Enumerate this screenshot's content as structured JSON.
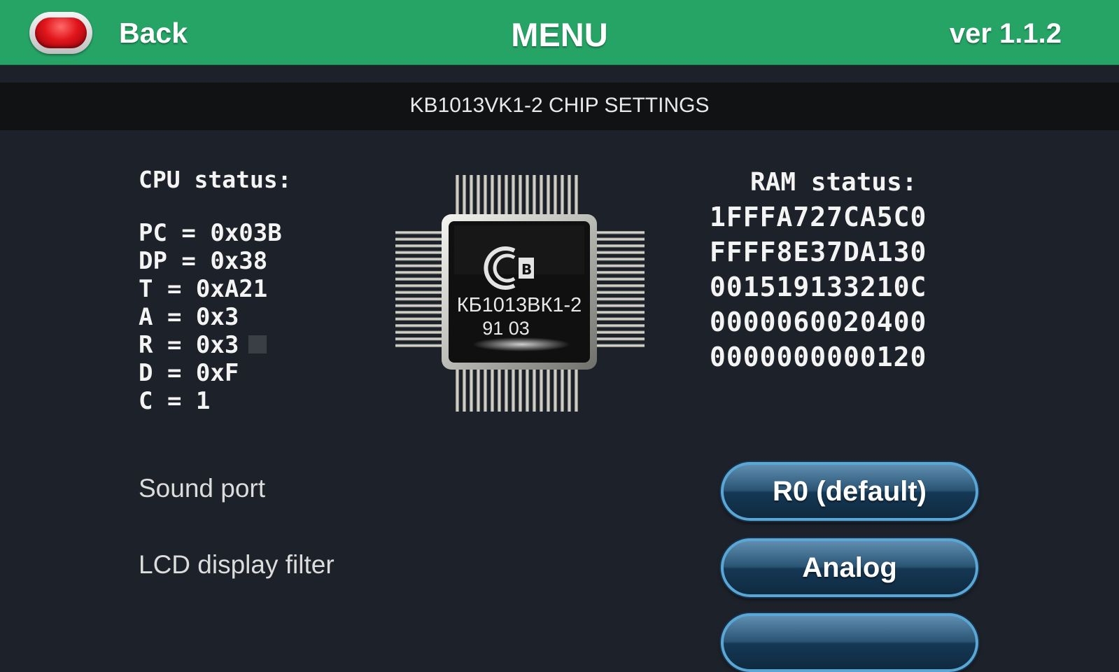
{
  "header": {
    "back_label": "Back",
    "title": "MENU",
    "version": "ver 1.1.2"
  },
  "section": {
    "title": "KB1013VK1-2 CHIP SETTINGS"
  },
  "cpu": {
    "title": "CPU status:",
    "registers": [
      "PC = 0x03B",
      "DP = 0x38",
      "T = 0xA21",
      "A = 0x3",
      "R = 0x3",
      "D = 0xF",
      "C = 1"
    ]
  },
  "chip": {
    "marking": "КБ1013ВК1-2",
    "date_code": "91 03"
  },
  "ram": {
    "title": "RAM status:",
    "rows": [
      "1FFFA727CA5C0",
      "FFFF8E37DA130",
      "001519133210C",
      "0000060020400",
      "0000000000120"
    ]
  },
  "settings": {
    "sound_port": {
      "label": "Sound port",
      "value": "R0 (default)"
    },
    "lcd_filter": {
      "label": "LCD display filter",
      "value": "Analog"
    }
  },
  "colors": {
    "header_green": "#26a466",
    "background": "#1d2129",
    "section_bar": "#111214",
    "button_blue": "#2a5474",
    "back_red": "#e0161b"
  }
}
